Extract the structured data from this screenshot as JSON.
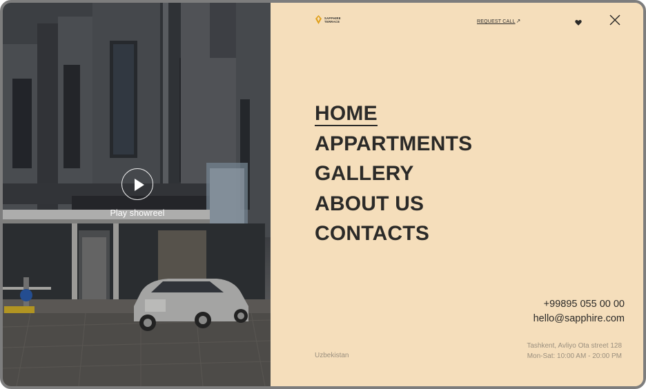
{
  "photo": {
    "play_label": "Play showreel"
  },
  "header": {
    "logo_line1": "SAPPHIRE",
    "logo_line2": "TERRACE",
    "request_call": "REQUEST CALL",
    "request_call_arrow": "↗"
  },
  "nav": {
    "items": [
      {
        "label": "HOME",
        "active": true
      },
      {
        "label": "APPARTMENTS",
        "active": false
      },
      {
        "label": "GALLERY",
        "active": false
      },
      {
        "label": "ABOUT US",
        "active": false
      },
      {
        "label": "CONTACTS",
        "active": false
      }
    ]
  },
  "contact": {
    "phone": "+99895 055 00 00",
    "email": "hello@sapphire.com"
  },
  "footer": {
    "country": "Uzbekistan",
    "address": "Tashkent, Avliyo Ota street 128",
    "hours": "Mon-Sat: 10:00 AM - 20:00 PM"
  },
  "colors": {
    "panel_bg": "#f5debb",
    "text": "#2b2a28",
    "muted": "#9a8f7e",
    "logo_accent": "#e0a01a"
  }
}
